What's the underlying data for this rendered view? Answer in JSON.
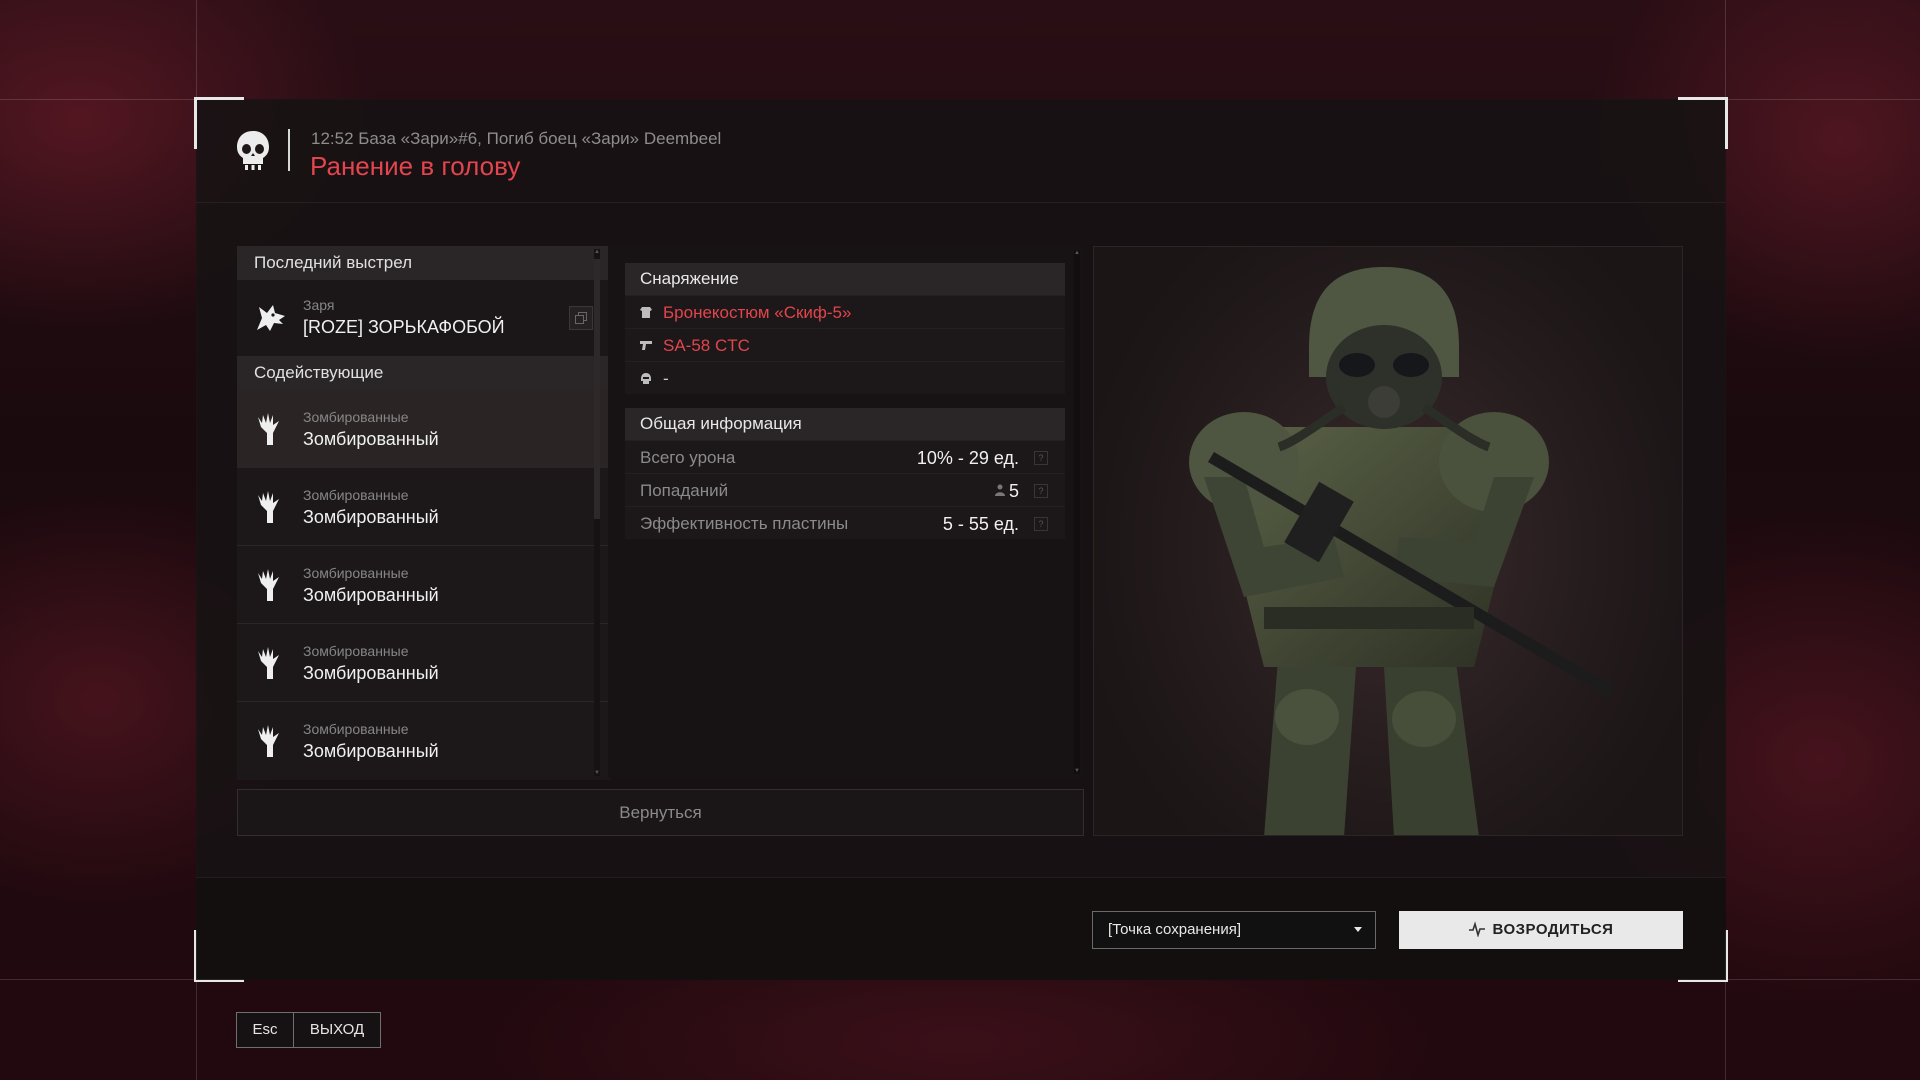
{
  "header": {
    "event_line": "12:52 База «Зари»#6, Погиб боец «Зари» Deembeel",
    "death_cause": "Ранение в голову"
  },
  "last_shot": {
    "title": "Последний выстрел",
    "faction": "Заря",
    "name": "[ROZE] ЗОРЬКАФОБОЙ"
  },
  "assistants": {
    "title": "Содействующие",
    "items": [
      {
        "faction": "Зомбированные",
        "name": "Зомбированный"
      },
      {
        "faction": "Зомбированные",
        "name": "Зомбированный"
      },
      {
        "faction": "Зомбированные",
        "name": "Зомбированный"
      },
      {
        "faction": "Зомбированные",
        "name": "Зомбированный"
      },
      {
        "faction": "Зомбированные",
        "name": "Зомбированный"
      }
    ]
  },
  "equipment": {
    "title": "Снаряжение",
    "items": [
      {
        "icon": "armor-icon",
        "label": "Бронекостюм «Скиф-5»"
      },
      {
        "icon": "gun-icon",
        "label": "SA-58 CTC"
      },
      {
        "icon": "helmet-icon",
        "label": "-"
      }
    ]
  },
  "general_info": {
    "title": "Общая информация",
    "rows": [
      {
        "label": "Всего урона",
        "value": "10% - 29 ед."
      },
      {
        "label": "Попаданий",
        "value": "5"
      },
      {
        "label": "Эффективность пластины",
        "value": "5 - 55 ед."
      }
    ]
  },
  "back_label": "Вернуться",
  "footer": {
    "spawn_select": "[Точка сохранения]",
    "respawn_label": "ВОЗРОДИТЬСЯ"
  },
  "exit": {
    "key": "Esc",
    "label": "ВЫХОД"
  },
  "colors": {
    "accent_red": "#e2454d",
    "panel": "#1f1a1b"
  }
}
